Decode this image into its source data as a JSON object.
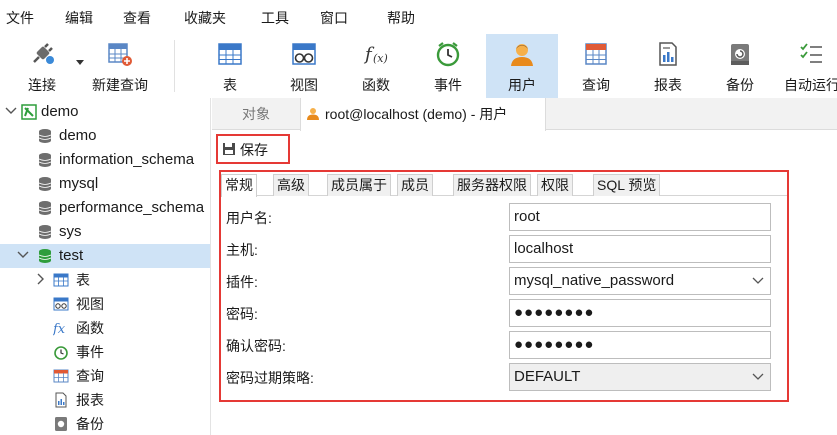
{
  "menu": [
    "文件",
    "编辑",
    "查看",
    "收藏夹",
    "工具",
    "窗口",
    "帮助"
  ],
  "toolbar": {
    "connect": "连接",
    "new_query": "新建查询",
    "table": "表",
    "view": "视图",
    "function": "函数",
    "event": "事件",
    "user": "用户",
    "query": "查询",
    "report": "报表",
    "backup": "备份",
    "auto_run": "自动运行"
  },
  "sidebar": {
    "connection": "demo",
    "databases": [
      "demo",
      "information_schema",
      "mysql",
      "performance_schema",
      "sys",
      "test"
    ],
    "test_children": [
      "表",
      "视图",
      "函数",
      "事件",
      "查询",
      "报表",
      "备份"
    ]
  },
  "tabs": {
    "objects": "对象",
    "user_tab": "root@localhost (demo) - 用户"
  },
  "save_label": "保存",
  "subtabs": [
    "常规",
    "高级",
    "成员属于",
    "成员",
    "服务器权限",
    "权限",
    "SQL 预览"
  ],
  "form": {
    "username_label": "用户名:",
    "username": "root",
    "host_label": "主机:",
    "host": "localhost",
    "plugin_label": "插件:",
    "plugin": "mysql_native_password",
    "password_label": "密码:",
    "password": "●●●●●●●●",
    "confirm_label": "确认密码:",
    "confirm": "●●●●●●●●",
    "expire_label": "密码过期策略:",
    "expire": "DEFAULT"
  },
  "colors": {
    "highlight_frame": "#e53935",
    "selection": "#cfe3f6",
    "db_green": "#2e9d3c"
  }
}
